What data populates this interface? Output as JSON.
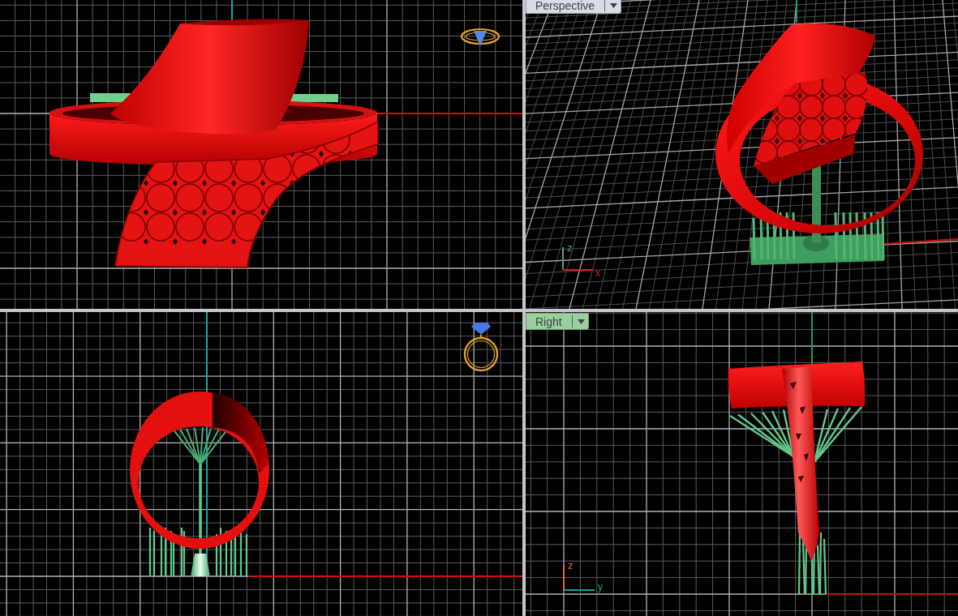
{
  "viewports": [
    {
      "kind": "top"
    },
    {
      "kind": "perspective",
      "label": "Perspective",
      "active": false,
      "axis_labels": [
        "z",
        "x"
      ]
    },
    {
      "kind": "front"
    },
    {
      "kind": "right",
      "label": "Right",
      "active": true,
      "axis_labels": [
        "z",
        "y"
      ]
    }
  ]
}
